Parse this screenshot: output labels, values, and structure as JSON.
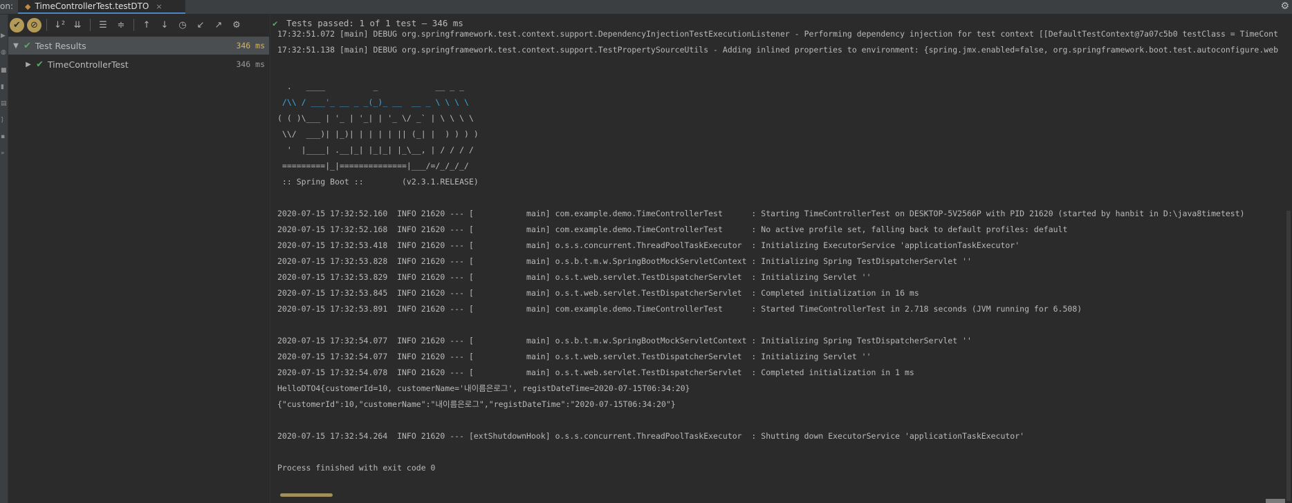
{
  "topbar": {
    "run_label": "on:",
    "tab_title": "TimeControllerTest.testDTO",
    "tab_close": "×",
    "settings_icon": "gear-icon"
  },
  "toolbar": {
    "icons": [
      "show-passed-icon",
      "show-ignored-icon",
      "sort-alpha-icon",
      "sort-duration-icon",
      "expand-all-icon",
      "collapse-all-icon",
      "previous-failed-icon",
      "next-failed-icon",
      "test-history-icon",
      "import-tests-icon",
      "export-tests-icon",
      "settings-icon"
    ]
  },
  "status": {
    "prefix": "Tests passed:",
    "count": "1",
    "suffix": "of 1 test – 346 ms"
  },
  "tree": {
    "items": [
      {
        "label": "Test Results",
        "time": "346 ms",
        "expanded": true
      },
      {
        "label": "TimeControllerTest",
        "time": "346 ms",
        "expanded": false
      }
    ]
  },
  "console": {
    "lines": [
      "17:32:51.072 [main] DEBUG org.springframework.test.context.support.DependencyInjectionTestExecutionListener - Performing dependency injection for test context [[DefaultTestContext@7a07c5b0 testClass = TimeCont",
      "17:32:51.138 [main] DEBUG org.springframework.test.context.support.TestPropertySourceUtils - Adding inlined properties to environment: {spring.jmx.enabled=false, org.springframework.boot.test.autoconfigure.web",
      "",
      "",
      "  .   ____          _            __ _ _",
      " /\\\\ / ___'_ __ _ _(_)_ __  __ _ \\ \\ \\ \\",
      "( ( )\\___ | '_ | '_| | '_ \\/ _` | \\ \\ \\ \\",
      " \\\\/  ___)| |_)| | | | | || (_| |  ) ) ) )",
      "  '  |____| .__|_| |_|_| |_\\__, | / / / /",
      " =========|_|==============|___/=/_/_/_/",
      " :: Spring Boot ::        (v2.3.1.RELEASE)",
      "",
      "2020-07-15 17:32:52.160  INFO 21620 --- [           main] com.example.demo.TimeControllerTest      : Starting TimeControllerTest on DESKTOP-5V2566P with PID 21620 (started by hanbit in D:\\java8timetest)",
      "2020-07-15 17:32:52.168  INFO 21620 --- [           main] com.example.demo.TimeControllerTest      : No active profile set, falling back to default profiles: default",
      "2020-07-15 17:32:53.418  INFO 21620 --- [           main] o.s.s.concurrent.ThreadPoolTaskExecutor  : Initializing ExecutorService 'applicationTaskExecutor'",
      "2020-07-15 17:32:53.828  INFO 21620 --- [           main] o.s.b.t.m.w.SpringBootMockServletContext : Initializing Spring TestDispatcherServlet ''",
      "2020-07-15 17:32:53.829  INFO 21620 --- [           main] o.s.t.web.servlet.TestDispatcherServlet  : Initializing Servlet ''",
      "2020-07-15 17:32:53.845  INFO 21620 --- [           main] o.s.t.web.servlet.TestDispatcherServlet  : Completed initialization in 16 ms",
      "2020-07-15 17:32:53.891  INFO 21620 --- [           main] com.example.demo.TimeControllerTest      : Started TimeControllerTest in 2.718 seconds (JVM running for 6.508)",
      "",
      "2020-07-15 17:32:54.077  INFO 21620 --- [           main] o.s.b.t.m.w.SpringBootMockServletContext : Initializing Spring TestDispatcherServlet ''",
      "2020-07-15 17:32:54.077  INFO 21620 --- [           main] o.s.t.web.servlet.TestDispatcherServlet  : Initializing Servlet ''",
      "2020-07-15 17:32:54.078  INFO 21620 --- [           main] o.s.t.web.servlet.TestDispatcherServlet  : Completed initialization in 1 ms",
      "HelloDTO4{customerId=10, customerName='내이름은로그', registDateTime=2020-07-15T06:34:20}",
      "{\"customerId\":10,\"customerName\":\"내이름은로그\",\"registDateTime\":\"2020-07-15T06:34:20\"}",
      "",
      "2020-07-15 17:32:54.264  INFO 21620 --- [extShutdownHook] o.s.s.concurrent.ThreadPoolTaskExecutor  : Shutting down ExecutorService 'applicationTaskExecutor'",
      "",
      "Process finished with exit code 0"
    ]
  }
}
